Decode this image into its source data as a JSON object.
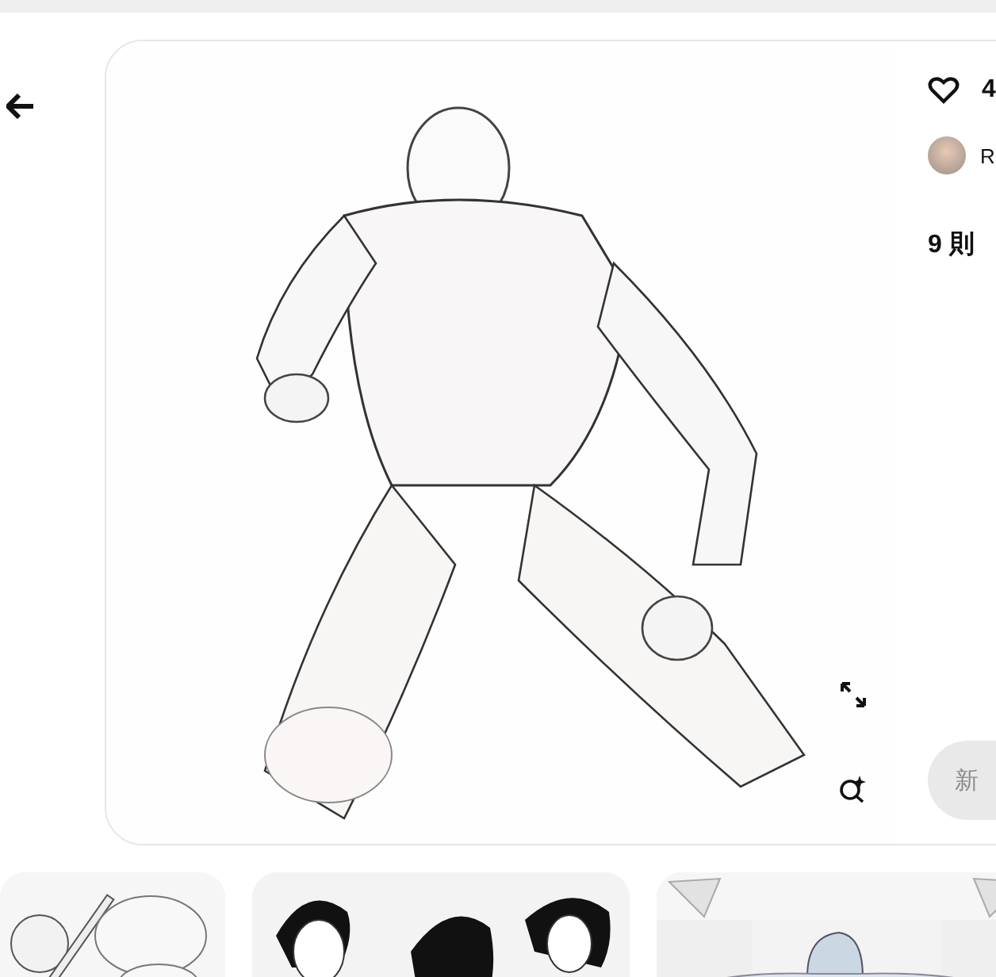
{
  "pin": {
    "likes": "4",
    "author": {
      "name": "R"
    },
    "comments_heading": "9 則",
    "comment_field": {
      "placeholder": "新"
    }
  }
}
